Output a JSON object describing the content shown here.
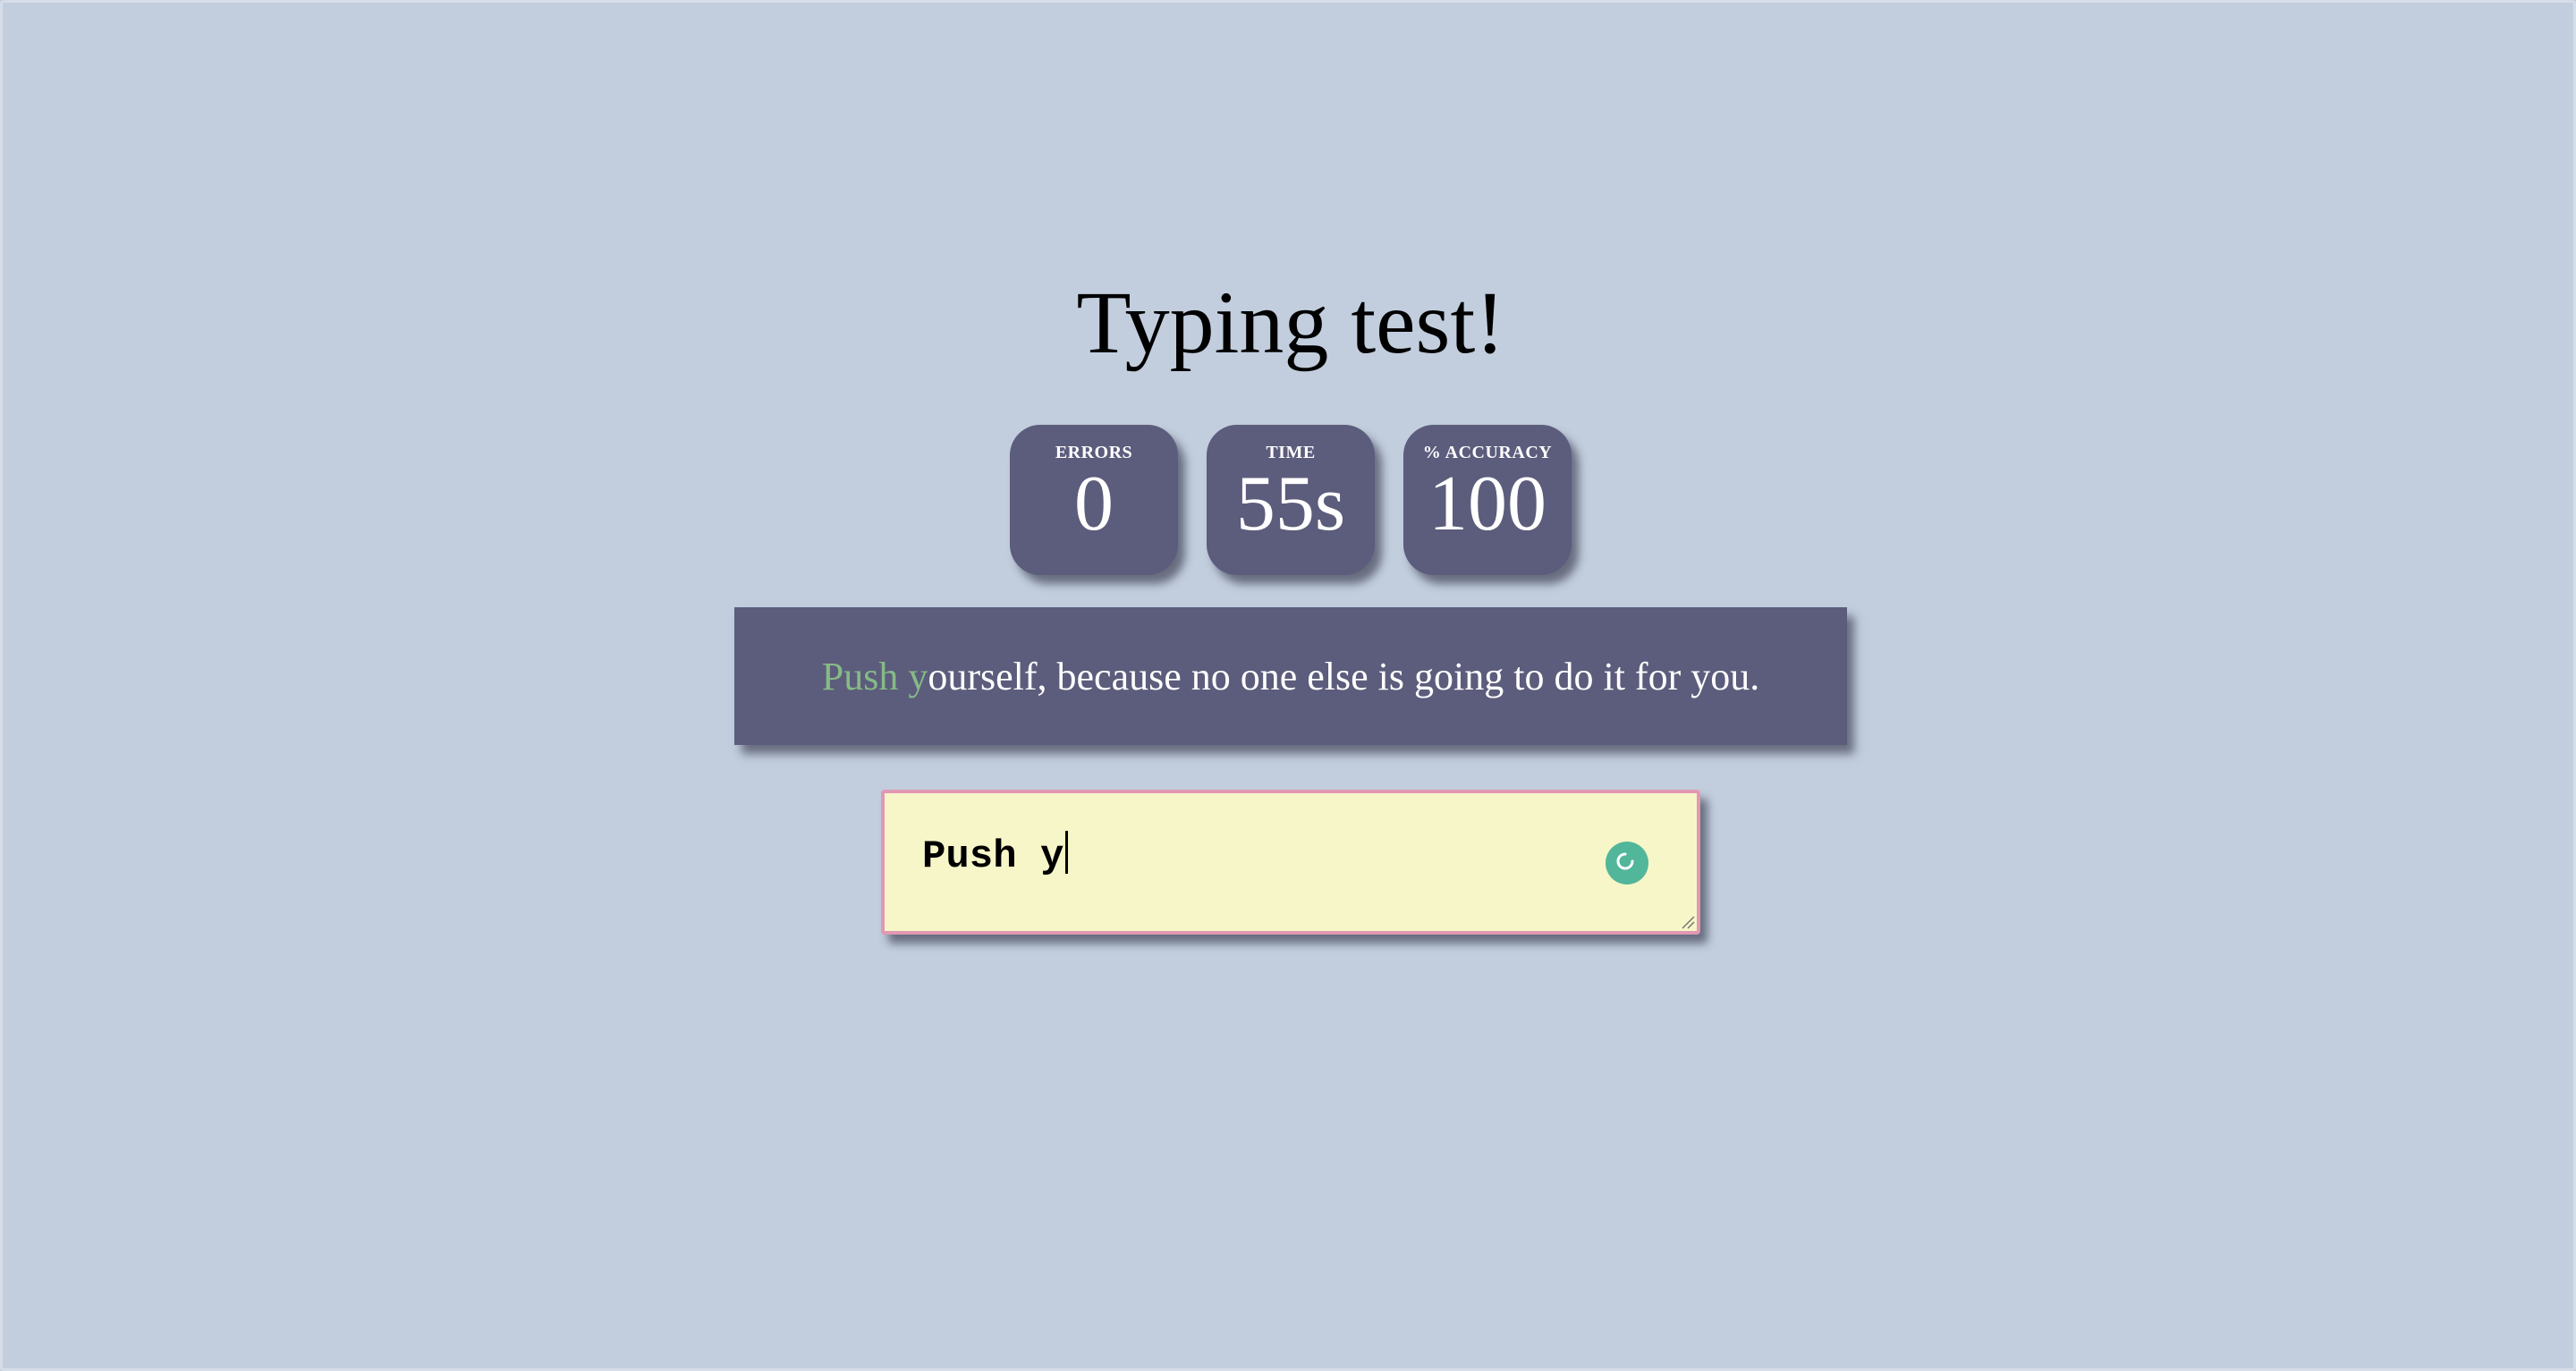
{
  "page": {
    "title": "Typing test!"
  },
  "stats": {
    "errors": {
      "label": "ERRORS",
      "value": "0"
    },
    "time": {
      "label": "TIME",
      "value": "55s"
    },
    "accuracy": {
      "label": "% ACCURACY",
      "value": "100"
    }
  },
  "quote": {
    "typed": "Push y",
    "remaining": "ourself, because no one else is going to do it for you."
  },
  "input": {
    "value": "Push y"
  },
  "icons": {
    "grammar": "grammar-check-icon",
    "resize": "resize-handle-icon"
  },
  "colors": {
    "background": "#c2cede",
    "panel": "#5c5c7c",
    "typed_correct": "#86ba86",
    "input_background": "#f6f6c8",
    "input_border": "#e298b2",
    "icon_accent": "#52b69a"
  }
}
